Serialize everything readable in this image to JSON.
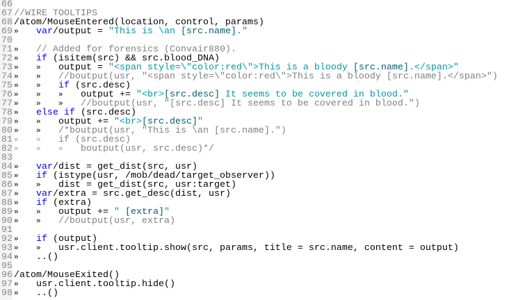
{
  "editor": {
    "tab_glyph": "»",
    "lines": [
      {
        "num": "66",
        "tokens": []
      },
      {
        "num": "67",
        "tokens": [
          [
            "c",
            "//WIRE TOOLTIPS"
          ]
        ]
      },
      {
        "num": "68",
        "tokens": [
          [
            "p",
            "/atom/MouseEntered(location, control, params)"
          ]
        ]
      },
      {
        "num": "69",
        "tokens": [
          [
            "t"
          ],
          [
            "k",
            "var"
          ],
          [
            "p",
            "/output = "
          ],
          [
            "s",
            "\"This is \\an "
          ],
          [
            "e",
            "[src.name]"
          ],
          [
            "s",
            ".\""
          ]
        ]
      },
      {
        "num": "70",
        "tokens": []
      },
      {
        "num": "71",
        "tokens": [
          [
            "t"
          ],
          [
            "c",
            "// Added for forensics (Convair880)."
          ]
        ]
      },
      {
        "num": "72",
        "tokens": [
          [
            "t"
          ],
          [
            "k",
            "if"
          ],
          [
            "p",
            " (isitem(src) && src.blood_DNA)"
          ]
        ]
      },
      {
        "num": "73",
        "tokens": [
          [
            "t"
          ],
          [
            "t"
          ],
          [
            "p",
            "output = "
          ],
          [
            "s",
            "\"<span style=\\\"color:red\\\">This is a bloody "
          ],
          [
            "e",
            "[src.name]"
          ],
          [
            "s",
            ".</span>\""
          ]
        ]
      },
      {
        "num": "74",
        "tokens": [
          [
            "t"
          ],
          [
            "t"
          ],
          [
            "c",
            "//boutput(usr, \"<span style=\\\"color:red\\\">This is a bloody [src.name].</span>\")"
          ]
        ]
      },
      {
        "num": "75",
        "tokens": [
          [
            "t"
          ],
          [
            "t"
          ],
          [
            "k",
            "if"
          ],
          [
            "p",
            " (src.desc)"
          ]
        ]
      },
      {
        "num": "76",
        "tokens": [
          [
            "t"
          ],
          [
            "t"
          ],
          [
            "t"
          ],
          [
            "p",
            "output += "
          ],
          [
            "s",
            "\"<br>"
          ],
          [
            "e",
            "[src.desc]"
          ],
          [
            "s",
            " It seems to be covered in blood.\""
          ]
        ]
      },
      {
        "num": "77",
        "tokens": [
          [
            "t"
          ],
          [
            "t"
          ],
          [
            "t"
          ],
          [
            "c",
            "//boutput(usr, \"[src.desc] It seems to be covered in blood.\")"
          ]
        ]
      },
      {
        "num": "78",
        "tokens": [
          [
            "t"
          ],
          [
            "k",
            "else if"
          ],
          [
            "p",
            " (src.desc)"
          ]
        ]
      },
      {
        "num": "79",
        "tokens": [
          [
            "t"
          ],
          [
            "t"
          ],
          [
            "p",
            "output += "
          ],
          [
            "s",
            "\"<br>"
          ],
          [
            "e",
            "[src.desc]"
          ],
          [
            "s",
            "\""
          ]
        ]
      },
      {
        "num": "80",
        "tokens": [
          [
            "t"
          ],
          [
            "t"
          ],
          [
            "c",
            "/*boutput(usr, \"This is \\an [src.name].\")"
          ]
        ]
      },
      {
        "num": "81",
        "tokens": [
          [
            "tc"
          ],
          [
            "tc"
          ],
          [
            "c",
            "if (src.desc)"
          ]
        ]
      },
      {
        "num": "82",
        "tokens": [
          [
            "tc"
          ],
          [
            "tc"
          ],
          [
            "tc"
          ],
          [
            "c",
            "boutput(usr, src.desc)*/"
          ]
        ]
      },
      {
        "num": "83",
        "tokens": []
      },
      {
        "num": "84",
        "tokens": [
          [
            "t"
          ],
          [
            "k",
            "var"
          ],
          [
            "p",
            "/dist = get_dist(src, usr)"
          ]
        ]
      },
      {
        "num": "85",
        "tokens": [
          [
            "t"
          ],
          [
            "k",
            "if"
          ],
          [
            "p",
            " (istype(usr, /mob/dead/target_observer))"
          ]
        ]
      },
      {
        "num": "86",
        "tokens": [
          [
            "t"
          ],
          [
            "t"
          ],
          [
            "p",
            "dist = get_dist(src, usr:target)"
          ]
        ]
      },
      {
        "num": "87",
        "tokens": [
          [
            "t"
          ],
          [
            "k",
            "var"
          ],
          [
            "p",
            "/extra = src.get_desc(dist, usr)"
          ]
        ]
      },
      {
        "num": "88",
        "tokens": [
          [
            "t"
          ],
          [
            "k",
            "if"
          ],
          [
            "p",
            " (extra)"
          ]
        ]
      },
      {
        "num": "89",
        "tokens": [
          [
            "t"
          ],
          [
            "t"
          ],
          [
            "p",
            "output += "
          ],
          [
            "s",
            "\" "
          ],
          [
            "e",
            "[extra]"
          ],
          [
            "s",
            "\""
          ]
        ]
      },
      {
        "num": "90",
        "tokens": [
          [
            "t"
          ],
          [
            "t"
          ],
          [
            "c",
            "//boutput(usr, extra)"
          ]
        ]
      },
      {
        "num": "91",
        "tokens": []
      },
      {
        "num": "92",
        "tokens": [
          [
            "t"
          ],
          [
            "k",
            "if"
          ],
          [
            "p",
            " (output)"
          ]
        ]
      },
      {
        "num": "93",
        "tokens": [
          [
            "t"
          ],
          [
            "t"
          ],
          [
            "p",
            "usr.client.tooltip.show(src, params, title = src.name, content = output)"
          ]
        ]
      },
      {
        "num": "94",
        "tokens": [
          [
            "t"
          ],
          [
            "p",
            "..()"
          ]
        ]
      },
      {
        "num": "95",
        "tokens": []
      },
      {
        "num": "96",
        "tokens": [
          [
            "p",
            "/atom/MouseExited()"
          ]
        ]
      },
      {
        "num": "97",
        "tokens": [
          [
            "t"
          ],
          [
            "p",
            "usr.client.tooltip.hide()"
          ]
        ]
      },
      {
        "num": "98",
        "tokens": [
          [
            "t"
          ],
          [
            "p",
            "..()"
          ]
        ]
      }
    ]
  }
}
